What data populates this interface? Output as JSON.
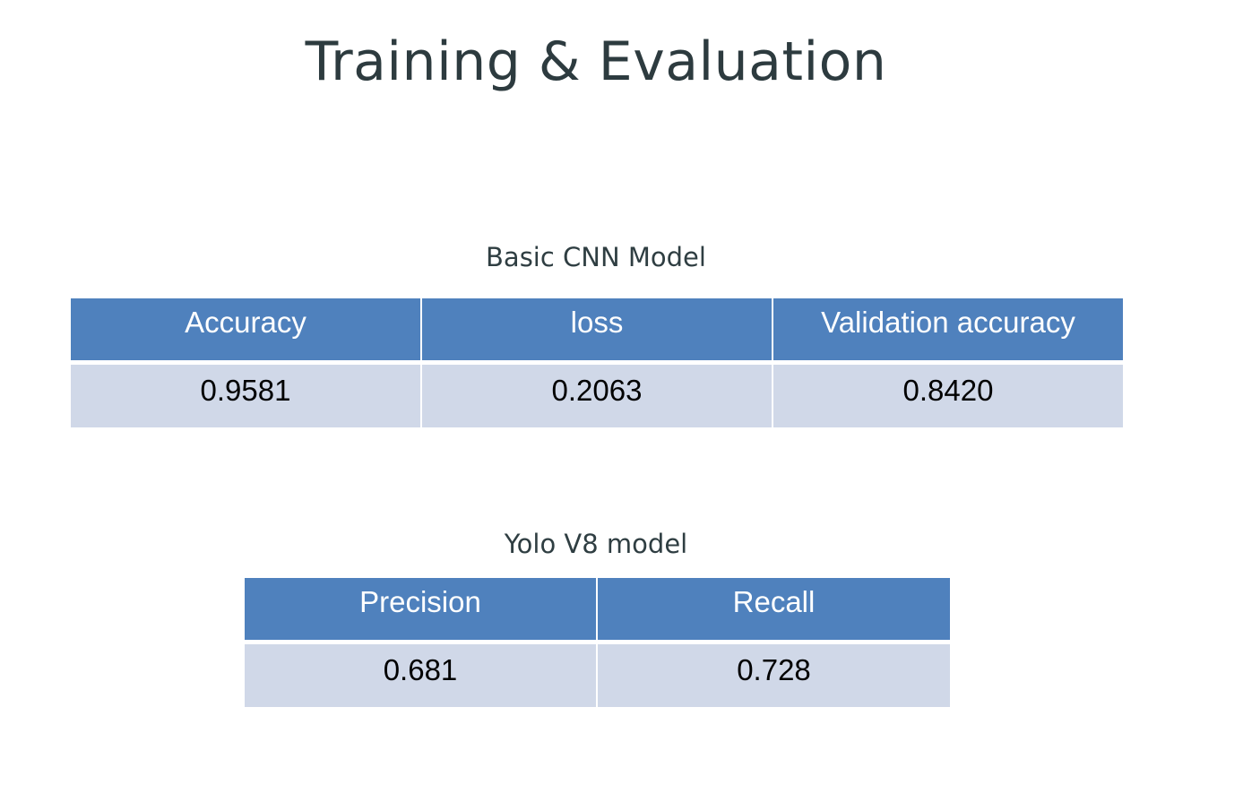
{
  "slide": {
    "title": "Training & Evaluation"
  },
  "cnn_table": {
    "caption": "Basic CNN Model",
    "headers": [
      "Accuracy",
      "loss",
      "Validation accuracy"
    ],
    "values": [
      "0.9581",
      "0.2063",
      "0.8420"
    ]
  },
  "yolo_table": {
    "caption": "Yolo V8 model",
    "headers": [
      "Precision",
      "Recall"
    ],
    "values": [
      "0.681",
      "0.728"
    ]
  },
  "colors": {
    "header_bg": "#4f81bd",
    "row_bg": "#d0d8e8",
    "title_text": "#2d3b3f"
  }
}
